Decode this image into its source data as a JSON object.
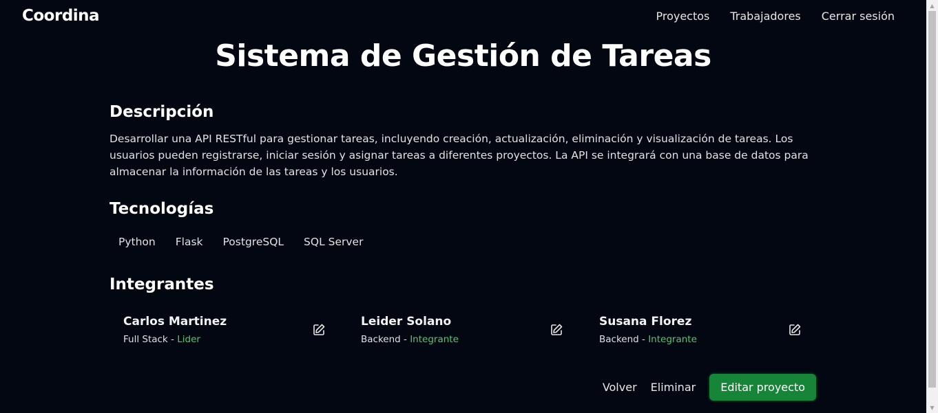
{
  "header": {
    "brand": "Coordina",
    "nav": [
      "Proyectos",
      "Trabajadores",
      "Cerrar sesión"
    ]
  },
  "page": {
    "title": "Sistema de Gestión de Tareas"
  },
  "description": {
    "heading": "Descripción",
    "text": "Desarrollar una API RESTful para gestionar tareas, incluyendo creación, actualización, eliminación y visualización de tareas. Los usuarios pueden registrarse, iniciar sesión y asignar tareas a diferentes proyectos. La API se integrará con una base de datos para almacenar la información de las tareas y los usuarios."
  },
  "technologies": {
    "heading": "Tecnologías",
    "items": [
      "Python",
      "Flask",
      "PostgreSQL",
      "SQL Server"
    ]
  },
  "members": {
    "heading": "Integrantes",
    "items": [
      {
        "name": "Carlos Martinez",
        "role": "Full Stack",
        "status": "Lider"
      },
      {
        "name": "Leider Solano",
        "role": "Backend",
        "status": "Integrante"
      },
      {
        "name": "Susana Florez",
        "role": "Backend",
        "status": "Integrante"
      }
    ],
    "separator": " - ",
    "edit_icon": "edit-icon"
  },
  "actions": {
    "back": "Volver",
    "delete": "Eliminar",
    "edit": "Editar proyecto"
  },
  "colors": {
    "background": "#020712",
    "accent": "#178538",
    "status": "#4ccb6e"
  }
}
